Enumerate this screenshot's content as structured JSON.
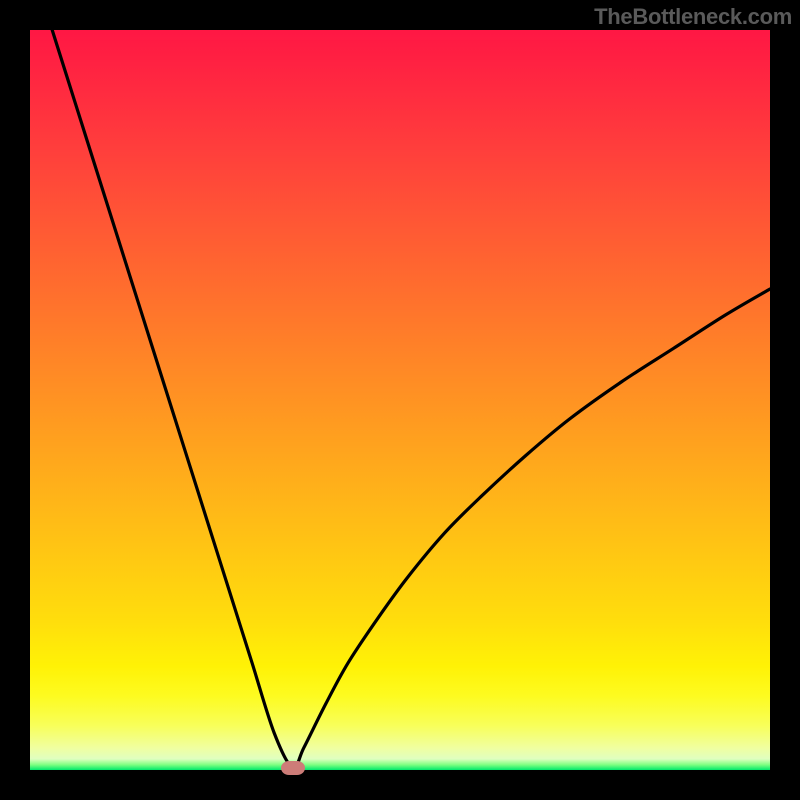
{
  "attribution": "TheBottleneck.com",
  "colors": {
    "frame": "#000000",
    "curve_stroke": "#000000",
    "marker": "#cd7c78",
    "gradient_top": "#ff1744",
    "gradient_bottom": "#00e86b",
    "attribution_text": "#5a5a5a"
  },
  "chart_data": {
    "type": "line",
    "title": "",
    "xlabel": "",
    "ylabel": "",
    "xlim": [
      0,
      100
    ],
    "ylim": [
      0,
      100
    ],
    "grid": false,
    "legend": false,
    "series": [
      {
        "name": "bottleneck-curve",
        "x": [
          3,
          6,
          9,
          12,
          15,
          18,
          21,
          24,
          27,
          30,
          33,
          35.5,
          37,
          40,
          43,
          47,
          51,
          56,
          61,
          67,
          73,
          80,
          87,
          94,
          100
        ],
        "values": [
          100,
          90.5,
          81,
          71.5,
          62,
          52.5,
          43,
          33.5,
          24,
          14.5,
          5,
          0.3,
          3,
          9,
          14.5,
          20.5,
          26,
          32,
          37,
          42.5,
          47.5,
          52.5,
          57,
          61.5,
          65
        ]
      }
    ],
    "marker": {
      "x": 35.5,
      "y": 0.3
    },
    "background_gradient": {
      "orientation": "vertical",
      "stops": [
        {
          "pos": 0.0,
          "color": "#ff1744"
        },
        {
          "pos": 0.5,
          "color": "#ff8e24"
        },
        {
          "pos": 0.86,
          "color": "#fff206"
        },
        {
          "pos": 0.97,
          "color": "#f0ffa0"
        },
        {
          "pos": 1.0,
          "color": "#00e86b"
        }
      ]
    }
  }
}
